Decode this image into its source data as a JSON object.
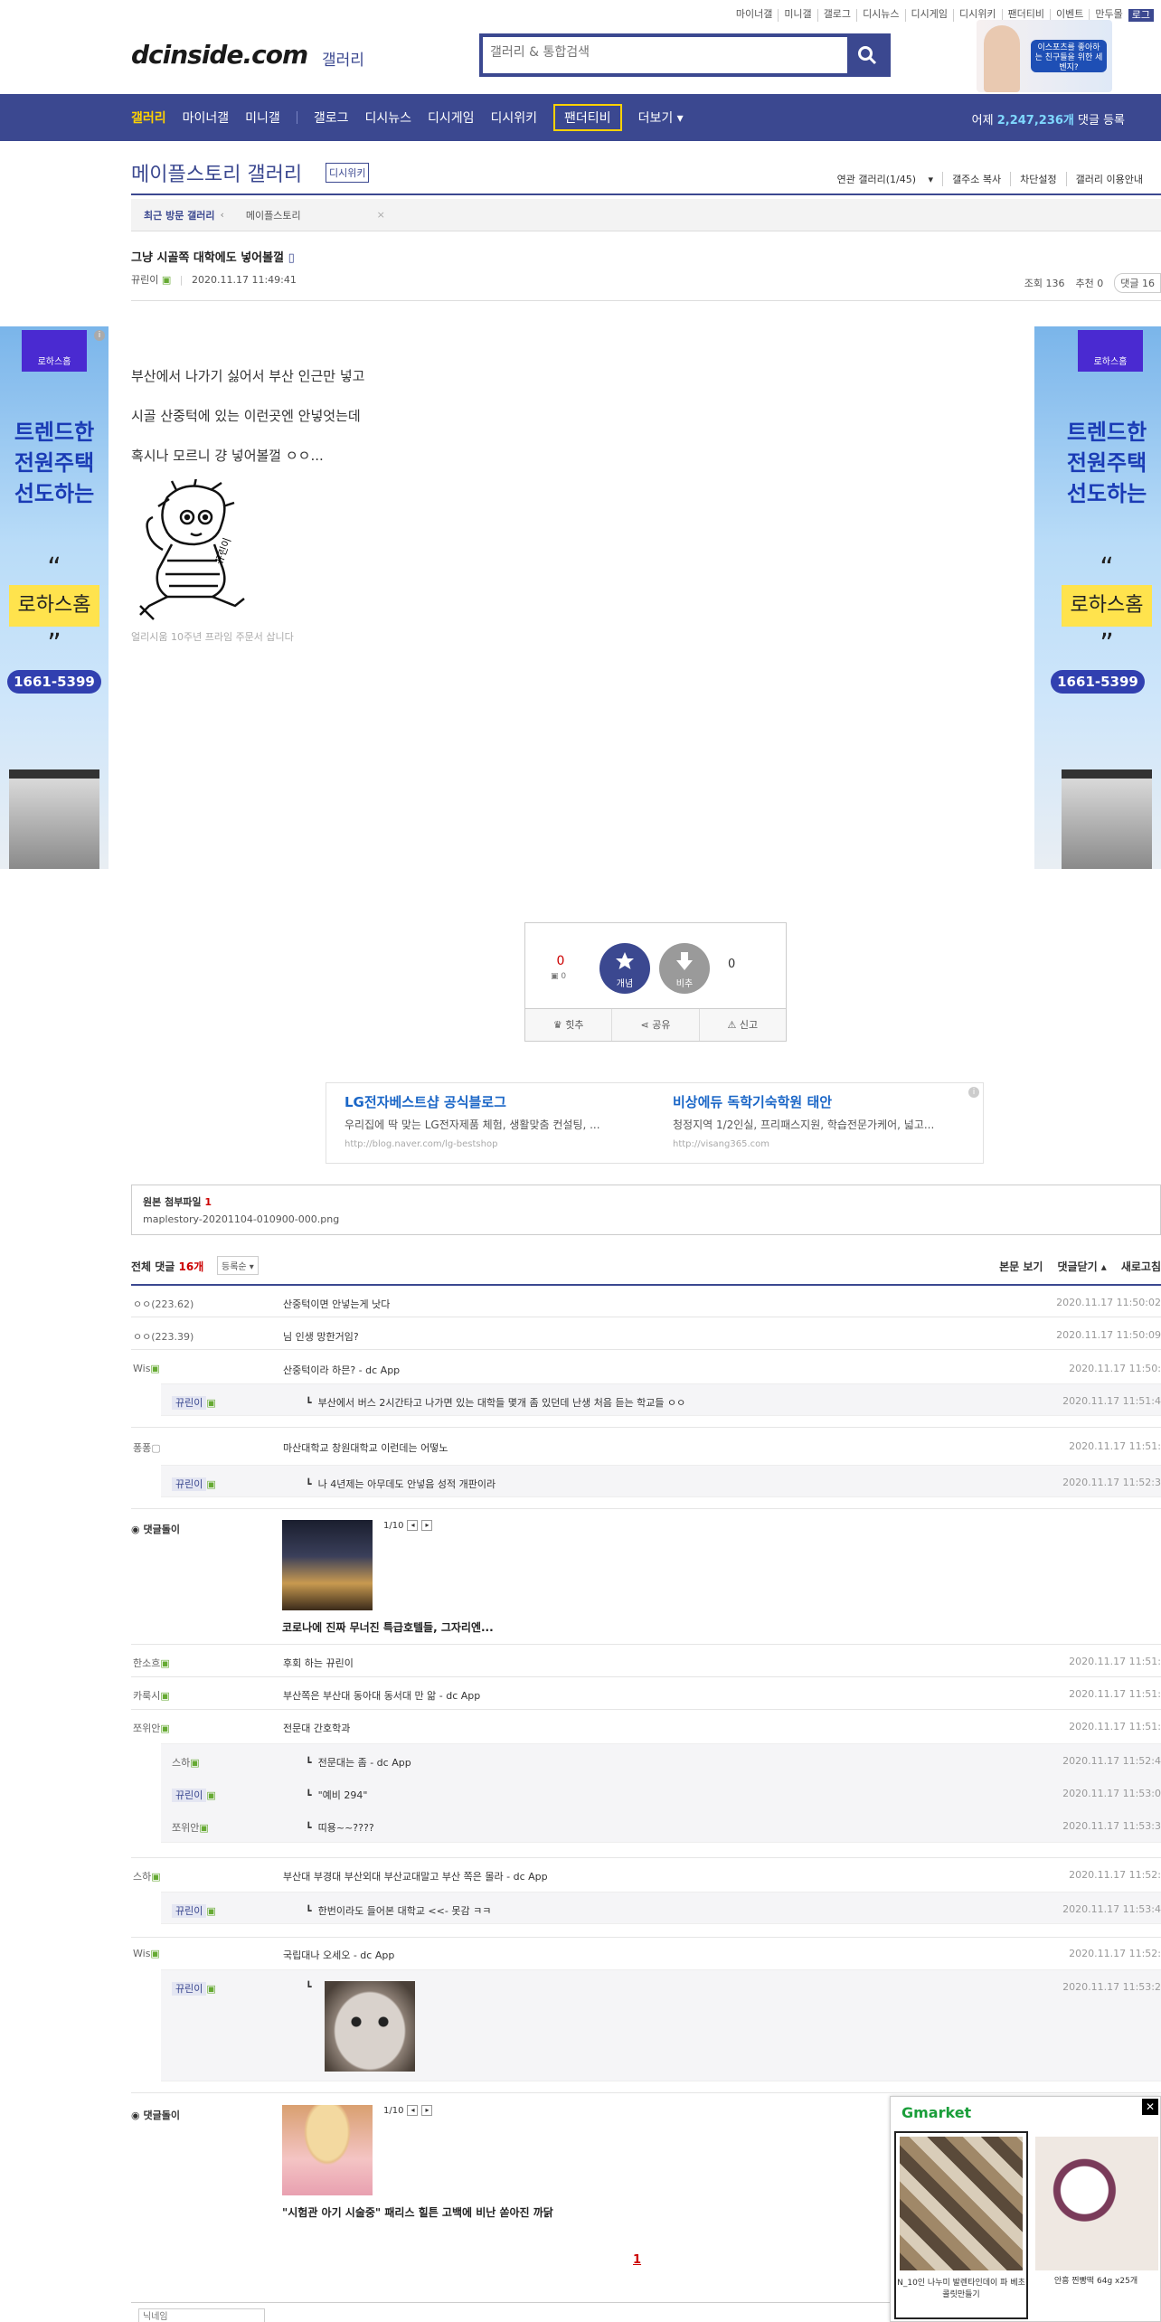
{
  "top_util": [
    "마이너갤",
    "미니갤",
    "갤로그",
    "디시뉴스",
    "디시게임",
    "디시위키",
    "팬더티비",
    "이벤트",
    "만두몰",
    "로그"
  ],
  "header": {
    "logo": "dcinside.com",
    "logo_sub": "갤러리",
    "search_placeholder": "갤러리 & 통합검색",
    "ad_text": "이스포츠를 좋아하는 친구들을 위한 세벤지?"
  },
  "nav": {
    "items": [
      "갤러리",
      "마이너갤",
      "미니갤",
      "갤로그",
      "디시뉴스",
      "디시게임",
      "디시위키",
      "팬더티비",
      "더보기"
    ],
    "count_prefix": "어제",
    "count": "2,247,236개",
    "count_suffix": "댓글 등록"
  },
  "gallery": {
    "title": "메이플스토리 갤러리",
    "wiki": "디시위키",
    "menu": [
      "연관 갤러리(1/45)",
      "갤주소 복사",
      "차단설정",
      "갤러리 이용안내"
    ],
    "recent_label": "최근 방문 갤러리",
    "recent_item": "메이플스토리",
    "recent_close": "×"
  },
  "post": {
    "title": "그냥 시골쪽 대학에도 넣어볼껄",
    "author": "뀨린이",
    "date": "2020.11.17 11:49:41",
    "views": "조회 136",
    "recommend": "추천 0",
    "comments": "댓글 16",
    "body": [
      "부산에서 나가기 싫어서 부산 인근만 넣고",
      "시골 산중턱에 있는 이런곳엔 안넣엇는데",
      "혹시나 모르니 걍 넣어볼껄 ㅇㅇ..."
    ],
    "signature": "얼리시움 10주년 프라임 주문서 삽니다",
    "sig_label": "뀨린이"
  },
  "side_ad": {
    "tag": "로하스홈",
    "headline": [
      "트렌드한",
      "전원주택",
      "선도하는"
    ],
    "brand": "로하스홈",
    "phone": "1661-5399"
  },
  "recommend": {
    "up": "0",
    "up_sub": "0",
    "up_label": "개념",
    "down_label": "비추",
    "down": "0",
    "actions": [
      "힛추",
      "공유",
      "신고"
    ]
  },
  "text_ads": [
    {
      "title": "LG전자베스트샵 공식블로그",
      "desc": "우리집에 딱 맞는 LG전자제품 체험, 생활맞춤 컨설팅, ...",
      "url": "http://blog.naver.com/lg-bestshop"
    },
    {
      "title": "비상에듀 독학기숙학원 태안",
      "desc": "청정지역 1/2인실, 프리패스지원, 학습전문가케어, 넓고...",
      "url": "http://visang365.com"
    }
  ],
  "attach": {
    "label": "원본 첨부파일",
    "count": "1",
    "file": "maplestory-20201104-010900-000.png"
  },
  "comments_head": {
    "label": "전체 댓글",
    "count": "16개",
    "sort": "등록순",
    "actions": [
      "본문 보기",
      "댓글닫기",
      "새로고침"
    ]
  },
  "comments": [
    {
      "nick": "ㅇㅇ(223.62)",
      "text": "산중턱이면 안넣는게 낫다",
      "date": "2020.11.17 11:50:02"
    },
    {
      "nick": "ㅇㅇ(223.39)",
      "text": "님 인생 망한거임?",
      "date": "2020.11.17 11:50:09"
    },
    {
      "nick": "Wis",
      "text": "산중턱이라 하믄? - dc App",
      "date": "2020.11.17 11:50:"
    },
    {
      "nick": "뀨린이",
      "text": "부산에서 버스 2시간타고 나가면 있는 대학들 몇개 좀 있던데 난생 처음 듣는 학교들 ㅇㅇ",
      "date": "2020.11.17 11:51:4"
    },
    {
      "nick": "퐁퐁",
      "text": "마산대학교 창원대학교 이런데는 어떻노",
      "date": "2020.11.17 11:51:"
    },
    {
      "nick": "뀨린이",
      "text": "나 4년제는 아무데도 안넣음 성적 개판이라",
      "date": "2020.11.17 11:52:3"
    },
    {
      "nick": "한소흐",
      "text": "후회 하는 뀨린이",
      "date": "2020.11.17 11:51:"
    },
    {
      "nick": "카룩시",
      "text": "부산쪽은 부산대 동아대 동서대 만 앎 - dc App",
      "date": "2020.11.17 11:51:"
    },
    {
      "nick": "쪼위안",
      "text": "전문대 간호학과",
      "date": "2020.11.17 11:51:"
    },
    {
      "nick": "스하",
      "text": "전문대는 좀 - dc App",
      "date": "2020.11.17 11:52:4"
    },
    {
      "nick": "뀨린이",
      "text": "\"예비 294\"",
      "date": "2020.11.17 11:53:0"
    },
    {
      "nick": "쪼위안",
      "text": "띠용~~????",
      "date": "2020.11.17 11:53:3"
    },
    {
      "nick": "스하",
      "text": "부산대 부경대 부산외대 부산교대말고 부산 쪽은 몰라 - dc App",
      "date": "2020.11.17 11:52:"
    },
    {
      "nick": "뀨린이",
      "text": "한번이라도 들어본 대학교 <<- 못감 ㅋㅋ",
      "date": "2020.11.17 11:53:4"
    },
    {
      "nick": "Wis",
      "text": "국립대나 오세오 - dc App",
      "date": "2020.11.17 11:52:"
    },
    {
      "nick": "뀨린이",
      "text": "",
      "date": "2020.11.17 11:53:2"
    }
  ],
  "dgl": [
    {
      "label": "댓글돌이",
      "pager": "1/10",
      "caption": "코로나에 진짜 무너진 특급호텔들, 그자리엔..."
    },
    {
      "label": "댓글돌이",
      "pager": "1/10",
      "caption": "\"시험관 아기 시술중\" 패리스 힐튼 고백에 비난 쏟아진 까닭"
    }
  ],
  "pagination": "1",
  "gmarket": {
    "brand": "Gmarket",
    "items": [
      {
        "caption": "N_10인 나누미 발렌타인데이 파 베초콜릿만들기"
      },
      {
        "caption": "안흥 찐빵떡 64g x25개"
      }
    ]
  },
  "bottom": {
    "nick_placeholder": "닉네임"
  },
  "colors": {
    "brand": "#3b4890",
    "accent": "#ffd200",
    "red": "#cc0000"
  }
}
